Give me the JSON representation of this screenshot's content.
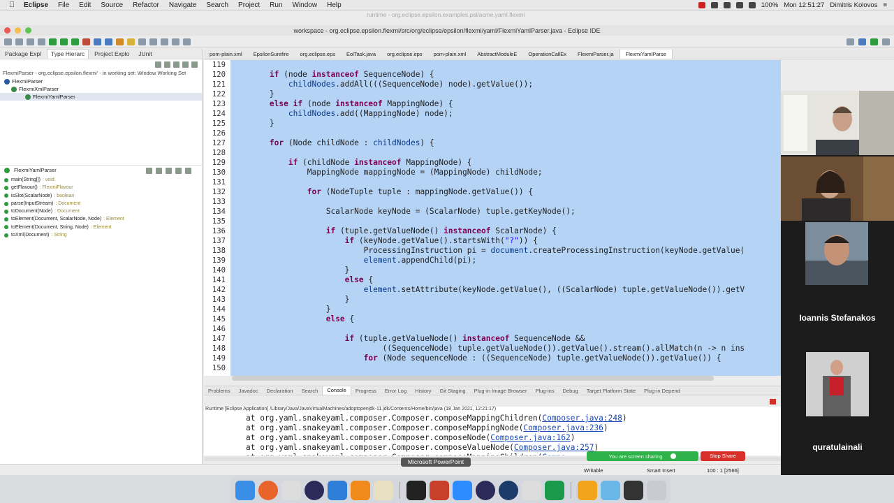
{
  "menubar": {
    "app": "Eclipse",
    "items": [
      "File",
      "Edit",
      "Source",
      "Refactor",
      "Navigate",
      "Search",
      "Project",
      "Run",
      "Window",
      "Help"
    ],
    "battery": "100%",
    "clock": "Mon 12:51:27",
    "user": "Dimitris Kolovos"
  },
  "ghost_title": "runtime - org.eclipse.epsilon.examples.psl/acme.yaml.flexmi",
  "window_title": "workspace - org.eclipse.epsilon.flexmi/src/org/eclipse/epsilon/flexmi/yaml/FlexmiYamlParser.java - Eclipse IDE",
  "left_tabs": [
    "Package Expl",
    "Type Hierarc",
    "Project Explo",
    "JUnit"
  ],
  "working_set": "FlexmiParser - org.eclipse.epsilon.flexmi' - in working set: Window Working Set",
  "hierarchy": [
    "FlexmiParser",
    "FlexmiXmlParser",
    "FlexmiYamlParser"
  ],
  "outline": {
    "title": "FlexmiYamlParser",
    "members": [
      {
        "name": "main(String[])",
        "type": ": void"
      },
      {
        "name": "getFlavour()",
        "type": ": FlexmiFlavour"
      },
      {
        "name": "isSlot(ScalarNode)",
        "type": ": boolean"
      },
      {
        "name": "parse(InputStream)",
        "type": ": Document"
      },
      {
        "name": "toDocument(Node)",
        "type": ": Document"
      },
      {
        "name": "toElement(Document, ScalarNode, Node)",
        "type": ": Element"
      },
      {
        "name": "toElement(Document, String, Node)",
        "type": ": Element"
      },
      {
        "name": "toXml(Document)",
        "type": ": String"
      }
    ]
  },
  "editor_tabs": [
    "pom-plain.xml",
    "EpsilonSurefire",
    "org.eclipse.eps",
    "EolTask.java",
    "org.eclipse.eps",
    "pom-plain.xml",
    "AbstractModuleE",
    "OperationCallEx",
    "FlexmiParser.ja",
    "FlexmiYamlParse"
  ],
  "code_lines": [
    {
      "n": "119",
      "t": ""
    },
    {
      "n": "120",
      "t": "        if (node instanceof SequenceNode) {"
    },
    {
      "n": "121",
      "t": "            childNodes.addAll(((SequenceNode) node).getValue());"
    },
    {
      "n": "122",
      "t": "        }"
    },
    {
      "n": "123",
      "t": "        else if (node instanceof MappingNode) {"
    },
    {
      "n": "124",
      "t": "            childNodes.add((MappingNode) node);"
    },
    {
      "n": "125",
      "t": "        }"
    },
    {
      "n": "126",
      "t": ""
    },
    {
      "n": "127",
      "t": "        for (Node childNode : childNodes) {"
    },
    {
      "n": "128",
      "t": ""
    },
    {
      "n": "129",
      "t": "            if (childNode instanceof MappingNode) {"
    },
    {
      "n": "130",
      "t": "                MappingNode mappingNode = (MappingNode) childNode;"
    },
    {
      "n": "131",
      "t": ""
    },
    {
      "n": "132",
      "t": "                for (NodeTuple tuple : mappingNode.getValue()) {"
    },
    {
      "n": "133",
      "t": ""
    },
    {
      "n": "134",
      "t": "                    ScalarNode keyNode = (ScalarNode) tuple.getKeyNode();"
    },
    {
      "n": "135",
      "t": ""
    },
    {
      "n": "136",
      "t": "                    if (tuple.getValueNode() instanceof ScalarNode) {"
    },
    {
      "n": "137",
      "t": "                        if (keyNode.getValue().startsWith(\"?\")) {"
    },
    {
      "n": "138",
      "t": "                            ProcessingInstruction pi = document.createProcessingInstruction(keyNode.getValue("
    },
    {
      "n": "139",
      "t": "                            element.appendChild(pi);"
    },
    {
      "n": "140",
      "t": "                        }"
    },
    {
      "n": "141",
      "t": "                        else {"
    },
    {
      "n": "142",
      "t": "                            element.setAttribute(keyNode.getValue(), ((ScalarNode) tuple.getValueNode()).getV"
    },
    {
      "n": "143",
      "t": "                        }"
    },
    {
      "n": "144",
      "t": "                    }"
    },
    {
      "n": "145",
      "t": "                    else {"
    },
    {
      "n": "146",
      "t": ""
    },
    {
      "n": "147",
      "t": "                        if (tuple.getValueNode() instanceof SequenceNode &&"
    },
    {
      "n": "148",
      "t": "                                ((SequenceNode) tuple.getValueNode()).getValue().stream().allMatch(n -> n ins"
    },
    {
      "n": "149",
      "t": "                            for (Node sequenceNode : ((SequenceNode) tuple.getValueNode()).getValue()) {"
    },
    {
      "n": "150",
      "t": ""
    }
  ],
  "bottom_tabs": [
    "Problems",
    "Javadoc",
    "Declaration",
    "Search",
    "Console",
    "Progress",
    "Error Log",
    "History",
    "Git Staging",
    "Plug-in Image Browser",
    "Plug-ins",
    "Debug",
    "Target Platform State",
    "Plug-in Depend"
  ],
  "console_header": "Runtime [Eclipse Application] /Library/Java/JavaVirtualMachines/adoptopenjdk-11.jdk/Contents/Home/bin/java  (18 Jan 2021, 12:21:17)",
  "console_lines": [
    {
      "pre": "at org.yaml.snakeyaml.composer.Composer.composeMappingChildren(",
      "link": "Composer.java:248",
      "post": ")"
    },
    {
      "pre": "at org.yaml.snakeyaml.composer.Composer.composeMappingNode(",
      "link": "Composer.java:236",
      "post": ")"
    },
    {
      "pre": "at org.yaml.snakeyaml.composer.Composer.composeNode(",
      "link": "Composer.java:162",
      "post": ")"
    },
    {
      "pre": "at org.yaml.snakeyaml.composer.Composer.composeValueNode(",
      "link": "Composer.java:257",
      "post": ")"
    },
    {
      "pre": "at org.yaml.snakeyaml.composer.Composer.composeMappingChildren(",
      "link": "Compo",
      "post": ""
    }
  ],
  "status": {
    "writable": "Writable",
    "insert": "Smart Insert",
    "pos": "100 : 1 [2566]"
  },
  "tooltip": "Microsoft PowerPoint",
  "share": {
    "banner": "You are screen sharing",
    "stop": "Stop Share"
  },
  "participants": [
    "Ioannis Stefanakos",
    "quratulainali"
  ],
  "colors": {
    "selection": "#b5d3f5",
    "keyword": "#7f0055",
    "link": "#1a47b5",
    "share_green": "#2fb24a",
    "stop_red": "#d8302a"
  }
}
